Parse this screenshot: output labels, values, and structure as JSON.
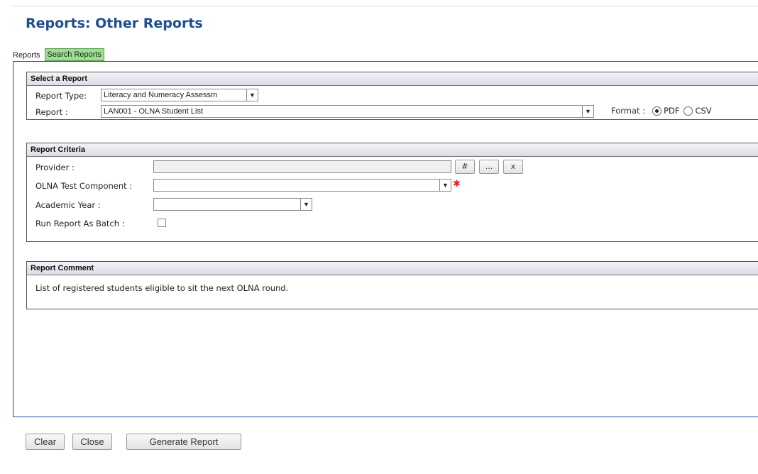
{
  "page": {
    "title": "Reports: Other Reports"
  },
  "tabs": [
    {
      "label": "Reports"
    },
    {
      "label": "Search Reports"
    }
  ],
  "select_report": {
    "heading": "Select a Report",
    "report_type_label": "Report Type:",
    "report_type_value": "Literacy and Numeracy Assessm",
    "report_label": "Report :",
    "report_value": "LAN001 - OLNA Student List",
    "format_label": "Format :",
    "format_options": [
      "PDF",
      "CSV"
    ],
    "format_selected": "PDF"
  },
  "criteria": {
    "heading": "Report Criteria",
    "provider_label": "Provider :",
    "provider_buttons": [
      "#",
      "...",
      "x"
    ],
    "component_label": "OLNA Test Component :",
    "required_mark": "✱",
    "year_label": "Academic Year :",
    "batch_label": "Run Report As Batch :"
  },
  "comment": {
    "heading": "Report Comment",
    "text": "List of registered students eligible to sit the next OLNA round."
  },
  "buttons": {
    "clear": "Clear",
    "close": "Close",
    "generate": "Generate Report"
  },
  "icons": {
    "dropdown": "chevron-down-icon",
    "required": "asterisk-icon"
  },
  "colors": {
    "title": "#1f4f8f",
    "tab_active_search": "#9be08f",
    "frame": "#1e4f9c",
    "required": "#e02020"
  }
}
